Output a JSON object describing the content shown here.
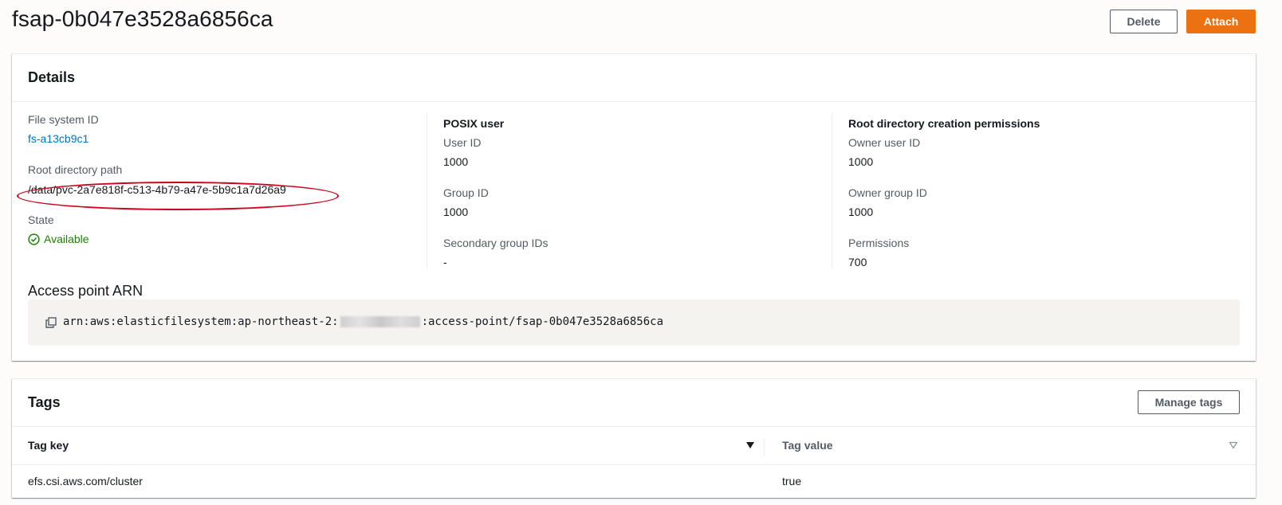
{
  "header": {
    "title": "fsap-0b047e3528a6856ca",
    "delete_label": "Delete",
    "attach_label": "Attach"
  },
  "details": {
    "heading": "Details",
    "file_system_id": {
      "label": "File system ID",
      "value": "fs-a13cb9c1"
    },
    "root_directory_path": {
      "label": "Root directory path",
      "value": "/data/pvc-2a7e818f-c513-4b79-a47e-5b9c1a7d26a9"
    },
    "state": {
      "label": "State",
      "value": "Available"
    },
    "posix_user": {
      "heading": "POSIX user",
      "user_id": {
        "label": "User ID",
        "value": "1000"
      },
      "group_id": {
        "label": "Group ID",
        "value": "1000"
      },
      "secondary_group_ids": {
        "label": "Secondary group IDs",
        "value": "-"
      }
    },
    "root_permissions": {
      "heading": "Root directory creation permissions",
      "owner_user_id": {
        "label": "Owner user ID",
        "value": "1000"
      },
      "owner_group_id": {
        "label": "Owner group ID",
        "value": "1000"
      },
      "permissions": {
        "label": "Permissions",
        "value": "700"
      }
    },
    "access_point_arn": {
      "label": "Access point ARN",
      "prefix": "arn:aws:elasticfilesystem:ap-northeast-2:",
      "suffix": ":access-point/fsap-0b047e3528a6856ca"
    }
  },
  "tags": {
    "heading": "Tags",
    "manage_label": "Manage tags",
    "columns": [
      "Tag key",
      "Tag value"
    ],
    "rows": [
      {
        "key": "efs.csi.aws.com/cluster",
        "value": "true"
      }
    ]
  },
  "colors": {
    "accent": "#ec7211",
    "link": "#0073bb",
    "success": "#1d8102",
    "annotation": "#d0021b"
  }
}
